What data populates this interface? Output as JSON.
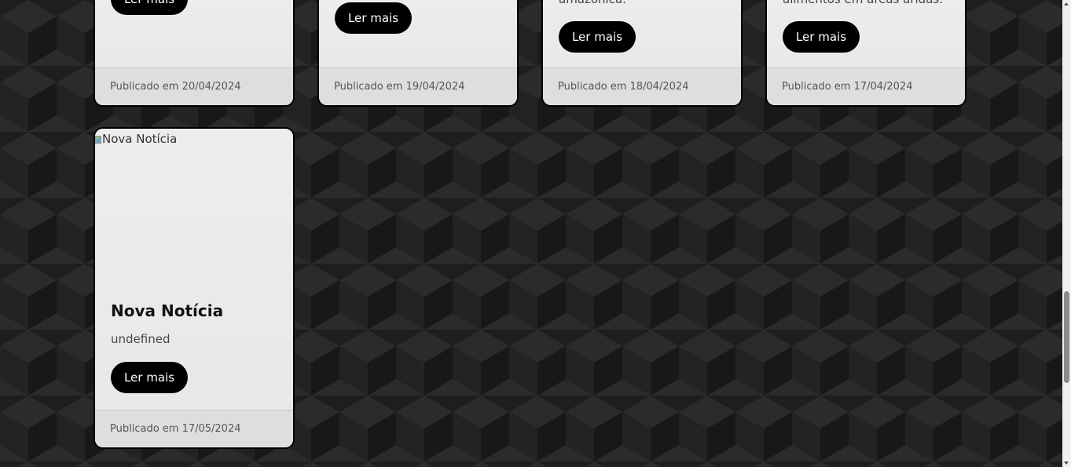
{
  "cards_top": [
    {
      "partial_text": "",
      "read_more": "Ler mais",
      "published": "Publicado em 20/04/2024"
    },
    {
      "partial_text": "",
      "read_more": "Ler mais",
      "published": "Publicado em 19/04/2024"
    },
    {
      "partial_text": "amazônica.",
      "read_more": "Ler mais",
      "published": "Publicado em 18/04/2024"
    },
    {
      "partial_text": "alimentos em áreas áridas.",
      "read_more": "Ler mais",
      "published": "Publicado em 17/04/2024"
    }
  ],
  "new_card": {
    "image_alt": "Nova Notícia",
    "title": "Nova Notícia",
    "description": "undefined",
    "read_more": "Ler mais",
    "published": "Publicado em 17/05/2024"
  },
  "colors": {
    "background_dark": "#1f1f1f",
    "card_bg": "#e9e9e9",
    "button_bg": "#000000",
    "button_text": "#ffffff"
  }
}
